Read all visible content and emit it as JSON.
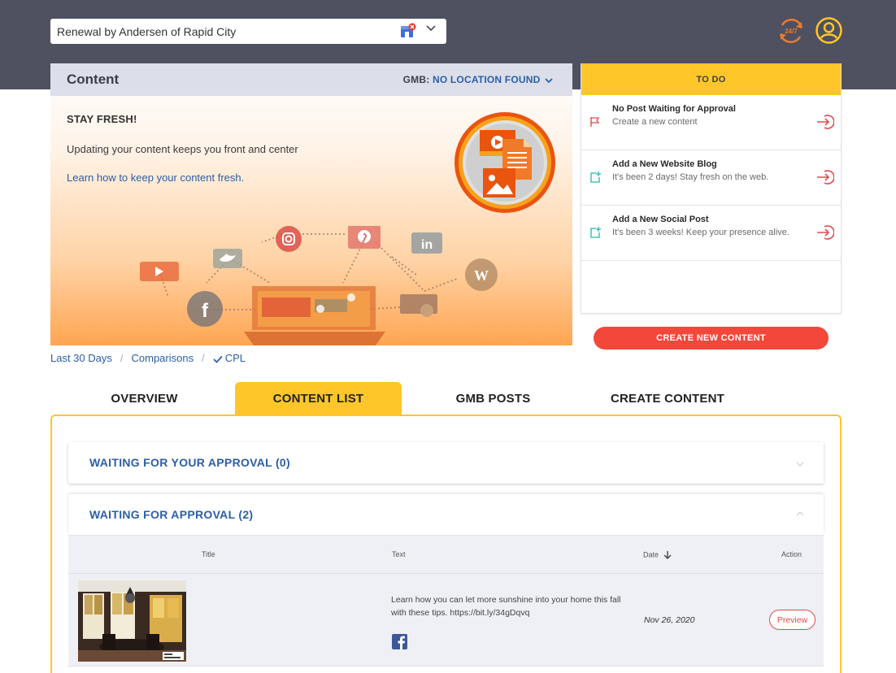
{
  "header": {
    "location_value": "Renewal by Andersen of Rapid City",
    "icons": [
      "gmb-store-icon",
      "chevron-down-icon",
      "support-24-7-icon",
      "user-account-icon"
    ]
  },
  "content_card": {
    "title": "Content",
    "gmb_label": "GMB:",
    "gmb_value": "NO LOCATION FOUND",
    "headline": "STAY FRESH!",
    "subtitle": "Updating your content keeps you front and center",
    "link": "Learn how to keep your content fresh."
  },
  "todo": {
    "title": "TO DO",
    "items": [
      {
        "title": "No Post Waiting for Approval",
        "subtitle": "Create a new content",
        "icon": "flag-icon"
      },
      {
        "title": "Add a New Website Blog",
        "subtitle": "It's been 2 days! Stay fresh on the web.",
        "icon": "add-note-icon"
      },
      {
        "title": "Add a New Social Post",
        "subtitle": "It's been 3 weeks! Keep your presence alive.",
        "icon": "add-note-icon"
      }
    ]
  },
  "create_button": "CREATE NEW CONTENT",
  "breadcrumb": [
    "Last 30 Days",
    "/",
    "Comparisons",
    "/",
    "CPL"
  ],
  "tabs": [
    "OVERVIEW",
    "CONTENT LIST",
    "GMB POSTS",
    "CREATE CONTENT"
  ],
  "active_tab": "CONTENT LIST",
  "sections": [
    {
      "title": "WAITING FOR YOUR APPROVAL (0)"
    },
    {
      "title": "WAITING FOR APPROVAL (2)"
    }
  ],
  "table": {
    "columns": [
      "Title",
      "Text",
      "Date",
      "Action"
    ],
    "rows": [
      {
        "text": "Learn how you can let more sunshine into your home this fall with these tips. https://bit.ly/34gDqvq",
        "date": "Nov 26, 2020",
        "action": "Preview",
        "network": "facebook-icon"
      }
    ]
  },
  "colors": {
    "topbar": "#4f5060",
    "accent_yellow": "#ffc629",
    "link_blue": "#2c5ea8",
    "cta_red": "#f2473a"
  }
}
